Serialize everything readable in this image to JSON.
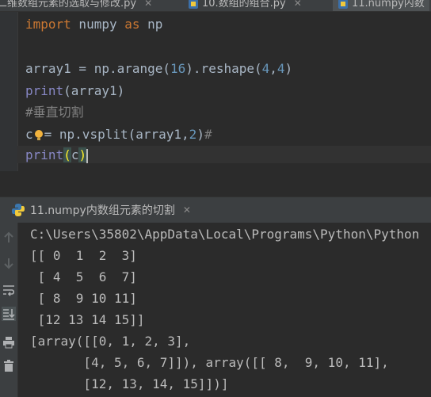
{
  "tabs": [
    {
      "label": "二维数组元素的选取与修改.py",
      "active": false
    },
    {
      "label": "10.数组的组合.py",
      "active": false
    },
    {
      "label": "11.numpy内数",
      "active": true
    }
  ],
  "editor": {
    "lines": [
      {
        "parts": [
          [
            "kw",
            "import"
          ],
          [
            "t",
            " numpy "
          ],
          [
            "kw",
            "as"
          ],
          [
            "t",
            " np"
          ]
        ]
      },
      {
        "parts": []
      },
      {
        "parts": [
          [
            "t",
            "array1 = np.arange("
          ],
          [
            "num",
            "16"
          ],
          [
            "t",
            ").reshape("
          ],
          [
            "num",
            "4"
          ],
          [
            "t",
            ","
          ],
          [
            "num",
            "4"
          ],
          [
            "t",
            ")"
          ]
        ]
      },
      {
        "parts": [
          [
            "fn",
            "print"
          ],
          [
            "t",
            "(array1)"
          ]
        ]
      },
      {
        "parts": [
          [
            "cm",
            "#垂直切割"
          ]
        ]
      },
      {
        "parts": [
          [
            "t",
            "c"
          ],
          [
            "bulb",
            ""
          ],
          [
            "t",
            "= np.vsplit(array1,"
          ],
          [
            "num",
            "2"
          ],
          [
            "t",
            ")"
          ],
          [
            "cm",
            "#"
          ]
        ]
      },
      {
        "parts": [
          [
            "fn",
            "print"
          ],
          [
            "br",
            "("
          ],
          [
            "t",
            "c"
          ],
          [
            "br",
            ")"
          ]
        ]
      }
    ]
  },
  "run": {
    "tab_label": "11.numpy内数组元素的切割",
    "output": [
      "C:\\Users\\35802\\AppData\\Local\\Programs\\Python\\Python",
      "[[ 0  1  2  3]",
      " [ 4  5  6  7]",
      " [ 8  9 10 11]",
      " [12 13 14 15]]",
      "[array([[0, 1, 2, 3],",
      "       [4, 5, 6, 7]]), array([[ 8,  9, 10, 11],",
      "       [12, 13, 14, 15]])]"
    ]
  },
  "colors": {
    "keyword": "#cc7832",
    "number": "#6897bb",
    "builtin": "#8888c6",
    "comment": "#808080",
    "background": "#2b2b2b"
  },
  "icons": [
    "python-file-icon",
    "close-icon",
    "up-arrow-icon",
    "down-arrow-icon",
    "soft-wrap-icon",
    "scroll-to-end-icon",
    "print-icon",
    "trash-icon",
    "lightbulb-icon"
  ]
}
